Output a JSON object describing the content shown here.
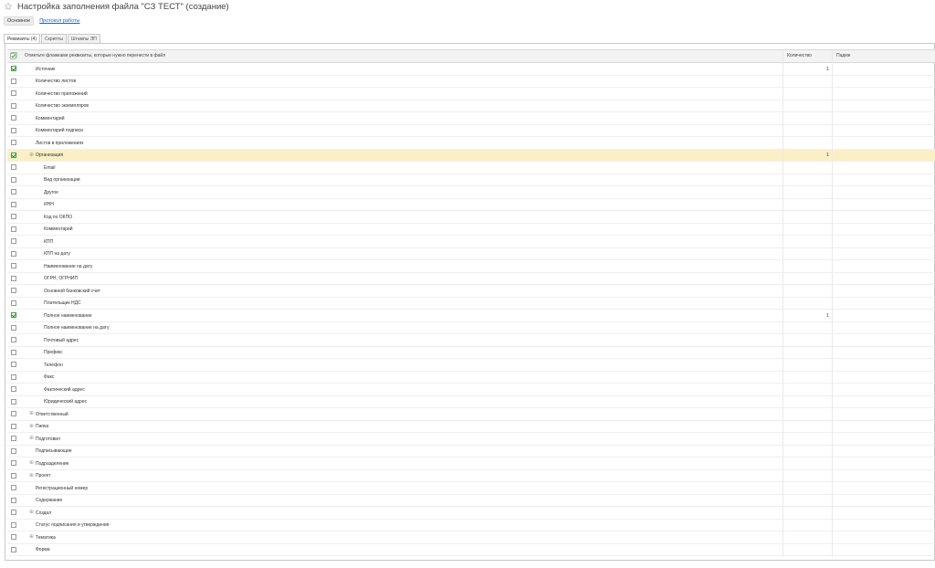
{
  "window": {
    "title": "Настройка заполнения файла \"СЗ ТЕСТ\" (создание)"
  },
  "commands": {
    "main": "Основное",
    "log": "Протокол работы"
  },
  "tabs": [
    {
      "label": "Реквизиты (4)",
      "active": true
    },
    {
      "label": "Скрипты",
      "active": false
    },
    {
      "label": "Штампы ЭП",
      "active": false
    }
  ],
  "table": {
    "columns": {
      "name": "Отметьте флажками реквизиты, которые нужно перенести в файл",
      "quantity": "Количество",
      "case": "Падеж"
    },
    "rows": [
      {
        "label": "Источник",
        "checked": true,
        "quantity": "1",
        "level": 0,
        "expandable": false,
        "selected": false
      },
      {
        "label": "Количество листов",
        "checked": false,
        "quantity": "",
        "level": 0,
        "expandable": false,
        "selected": false
      },
      {
        "label": "Количество приложений",
        "checked": false,
        "quantity": "",
        "level": 0,
        "expandable": false,
        "selected": false
      },
      {
        "label": "Количество экземпляров",
        "checked": false,
        "quantity": "",
        "level": 0,
        "expandable": false,
        "selected": false
      },
      {
        "label": "Комментарий",
        "checked": false,
        "quantity": "",
        "level": 0,
        "expandable": false,
        "selected": false
      },
      {
        "label": "Комментарий подписи",
        "checked": false,
        "quantity": "",
        "level": 0,
        "expandable": false,
        "selected": false
      },
      {
        "label": "Листов в приложениях",
        "checked": false,
        "quantity": "",
        "level": 0,
        "expandable": false,
        "selected": false
      },
      {
        "label": "Организация",
        "checked": true,
        "quantity": "1",
        "level": 0,
        "expandable": true,
        "selected": true
      },
      {
        "label": "Email",
        "checked": false,
        "quantity": "",
        "level": 1,
        "expandable": false,
        "selected": false
      },
      {
        "label": "Вид организации",
        "checked": false,
        "quantity": "",
        "level": 1,
        "expandable": false,
        "selected": false
      },
      {
        "label": "Другое",
        "checked": false,
        "quantity": "",
        "level": 1,
        "expandable": false,
        "selected": false
      },
      {
        "label": "ИНН",
        "checked": false,
        "quantity": "",
        "level": 1,
        "expandable": false,
        "selected": false
      },
      {
        "label": "Код по ОКПО",
        "checked": false,
        "quantity": "",
        "level": 1,
        "expandable": false,
        "selected": false
      },
      {
        "label": "Комментарий",
        "checked": false,
        "quantity": "",
        "level": 1,
        "expandable": false,
        "selected": false
      },
      {
        "label": "КПП",
        "checked": false,
        "quantity": "",
        "level": 1,
        "expandable": false,
        "selected": false
      },
      {
        "label": "КПП на дату",
        "checked": false,
        "quantity": "",
        "level": 1,
        "expandable": false,
        "selected": false
      },
      {
        "label": "Наименование на дату",
        "checked": false,
        "quantity": "",
        "level": 1,
        "expandable": false,
        "selected": false
      },
      {
        "label": "ОГРН, ОГРНИП",
        "checked": false,
        "quantity": "",
        "level": 1,
        "expandable": false,
        "selected": false
      },
      {
        "label": "Основной банковский счет",
        "checked": false,
        "quantity": "",
        "level": 1,
        "expandable": false,
        "selected": false
      },
      {
        "label": "Плательщик НДС",
        "checked": false,
        "quantity": "",
        "level": 1,
        "expandable": false,
        "selected": false
      },
      {
        "label": "Полное наименование",
        "checked": true,
        "quantity": "1",
        "level": 1,
        "expandable": false,
        "selected": false
      },
      {
        "label": "Полное наименование на дату",
        "checked": false,
        "quantity": "",
        "level": 1,
        "expandable": false,
        "selected": false
      },
      {
        "label": "Почтовый адрес",
        "checked": false,
        "quantity": "",
        "level": 1,
        "expandable": false,
        "selected": false
      },
      {
        "label": "Префикс",
        "checked": false,
        "quantity": "",
        "level": 1,
        "expandable": false,
        "selected": false
      },
      {
        "label": "Телефон",
        "checked": false,
        "quantity": "",
        "level": 1,
        "expandable": false,
        "selected": false
      },
      {
        "label": "Факс",
        "checked": false,
        "quantity": "",
        "level": 1,
        "expandable": false,
        "selected": false
      },
      {
        "label": "Фактический адрес",
        "checked": false,
        "quantity": "",
        "level": 1,
        "expandable": false,
        "selected": false
      },
      {
        "label": "Юридический адрес",
        "checked": false,
        "quantity": "",
        "level": 1,
        "expandable": false,
        "selected": false
      },
      {
        "label": "Ответственный",
        "checked": false,
        "quantity": "",
        "level": 0,
        "expandable": true,
        "selected": false
      },
      {
        "label": "Папка",
        "checked": false,
        "quantity": "",
        "level": 0,
        "expandable": true,
        "selected": false
      },
      {
        "label": "Подготовил",
        "checked": false,
        "quantity": "",
        "level": 0,
        "expandable": true,
        "selected": false
      },
      {
        "label": "Подписывающие",
        "checked": false,
        "quantity": "",
        "level": 0,
        "expandable": false,
        "selected": false
      },
      {
        "label": "Подразделение",
        "checked": false,
        "quantity": "",
        "level": 0,
        "expandable": true,
        "selected": false
      },
      {
        "label": "Проект",
        "checked": false,
        "quantity": "",
        "level": 0,
        "expandable": true,
        "selected": false
      },
      {
        "label": "Регистрационный номер",
        "checked": false,
        "quantity": "",
        "level": 0,
        "expandable": false,
        "selected": false
      },
      {
        "label": "Содержание",
        "checked": false,
        "quantity": "",
        "level": 0,
        "expandable": false,
        "selected": false
      },
      {
        "label": "Создал",
        "checked": false,
        "quantity": "",
        "level": 0,
        "expandable": true,
        "selected": false
      },
      {
        "label": "Статус подписания и утверждения",
        "checked": false,
        "quantity": "",
        "level": 0,
        "expandable": false,
        "selected": false
      },
      {
        "label": "Тематика",
        "checked": false,
        "quantity": "",
        "level": 0,
        "expandable": true,
        "selected": false
      },
      {
        "label": "Форма",
        "checked": false,
        "quantity": "",
        "level": 0,
        "expandable": false,
        "selected": false
      }
    ]
  },
  "icons": {
    "favorite": "star-icon",
    "header_check": "check-all-icon",
    "expand": "plus-expand-icon"
  },
  "colors": {
    "selected_row": "#fbf0c5",
    "check": "#1e8a1e",
    "link": "#2a5db0"
  }
}
